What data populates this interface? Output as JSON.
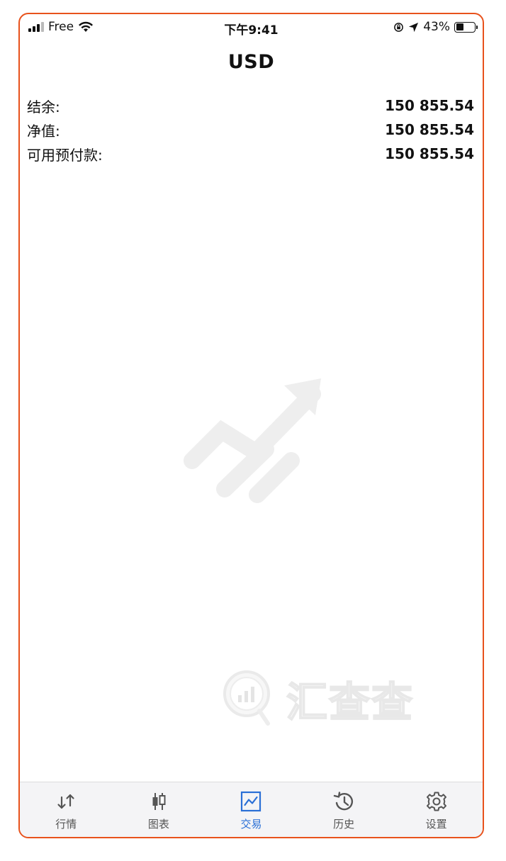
{
  "status_bar": {
    "carrier": "Free",
    "time": "下午9:41",
    "battery": "43%",
    "battery_level": 0.43
  },
  "header": {
    "title": "USD"
  },
  "account": {
    "rows": [
      {
        "label": "结余:",
        "value": "150 855.54"
      },
      {
        "label": "净值:",
        "value": "150 855.54"
      },
      {
        "label": "可用预付款:",
        "value": "150 855.54"
      }
    ]
  },
  "watermark": {
    "text": "汇查查"
  },
  "tabs": [
    {
      "label": "行情",
      "icon": "quotes-arrows-icon",
      "active": false
    },
    {
      "label": "图表",
      "icon": "candlestick-icon",
      "active": false
    },
    {
      "label": "交易",
      "icon": "trade-chart-icon",
      "active": true
    },
    {
      "label": "历史",
      "icon": "history-clock-icon",
      "active": false
    },
    {
      "label": "设置",
      "icon": "gear-icon",
      "active": false
    }
  ],
  "colors": {
    "accent": "#2a6fd6",
    "frame": "#e8521c"
  }
}
